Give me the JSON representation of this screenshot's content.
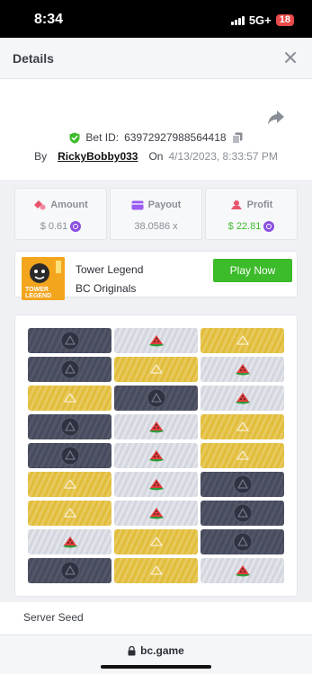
{
  "status": {
    "time": "8:34",
    "network": "5G+",
    "battery": "18"
  },
  "header": {
    "title": "Details"
  },
  "bet": {
    "id_label": "Bet ID:",
    "id": "63972927988564418",
    "by_label": "By",
    "username": "RickyBobby033",
    "on_label": "On",
    "datetime": "4/13/2023, 8:33:57 PM"
  },
  "stats": {
    "amount_label": "Amount",
    "amount_value": "$ 0.61",
    "payout_label": "Payout",
    "payout_value": "38.0586 x",
    "profit_label": "Profit",
    "profit_value": "$ 22.81"
  },
  "game": {
    "title": "Tower Legend",
    "provider": "BC Originals",
    "play_label": "Play Now",
    "thumb_text_1": "TOWER",
    "thumb_text_2": "LEGEND"
  },
  "board": {
    "rows": [
      [
        "dark-egg",
        "gray-melon",
        "gold-egg"
      ],
      [
        "dark-egg",
        "gold-egg",
        "gray-melon"
      ],
      [
        "gold-egg",
        "dark-egg",
        "gray-melon"
      ],
      [
        "dark-egg",
        "gray-melon",
        "gold-egg"
      ],
      [
        "dark-egg",
        "gray-melon",
        "gold-egg"
      ],
      [
        "gold-egg",
        "gray-melon",
        "dark-egg"
      ],
      [
        "gold-egg",
        "gray-melon",
        "dark-egg"
      ],
      [
        "gray-melon",
        "gold-egg",
        "dark-egg"
      ],
      [
        "dark-egg",
        "gold-egg",
        "gray-melon"
      ]
    ]
  },
  "seed": {
    "label": "Server Seed"
  },
  "browser": {
    "url": "bc.game"
  },
  "colors": {
    "accent_green": "#3cbb2b",
    "coin_purple": "#8a4fe0",
    "gold_tile": "#e2bd3a",
    "dark_tile": "#474b5e"
  }
}
